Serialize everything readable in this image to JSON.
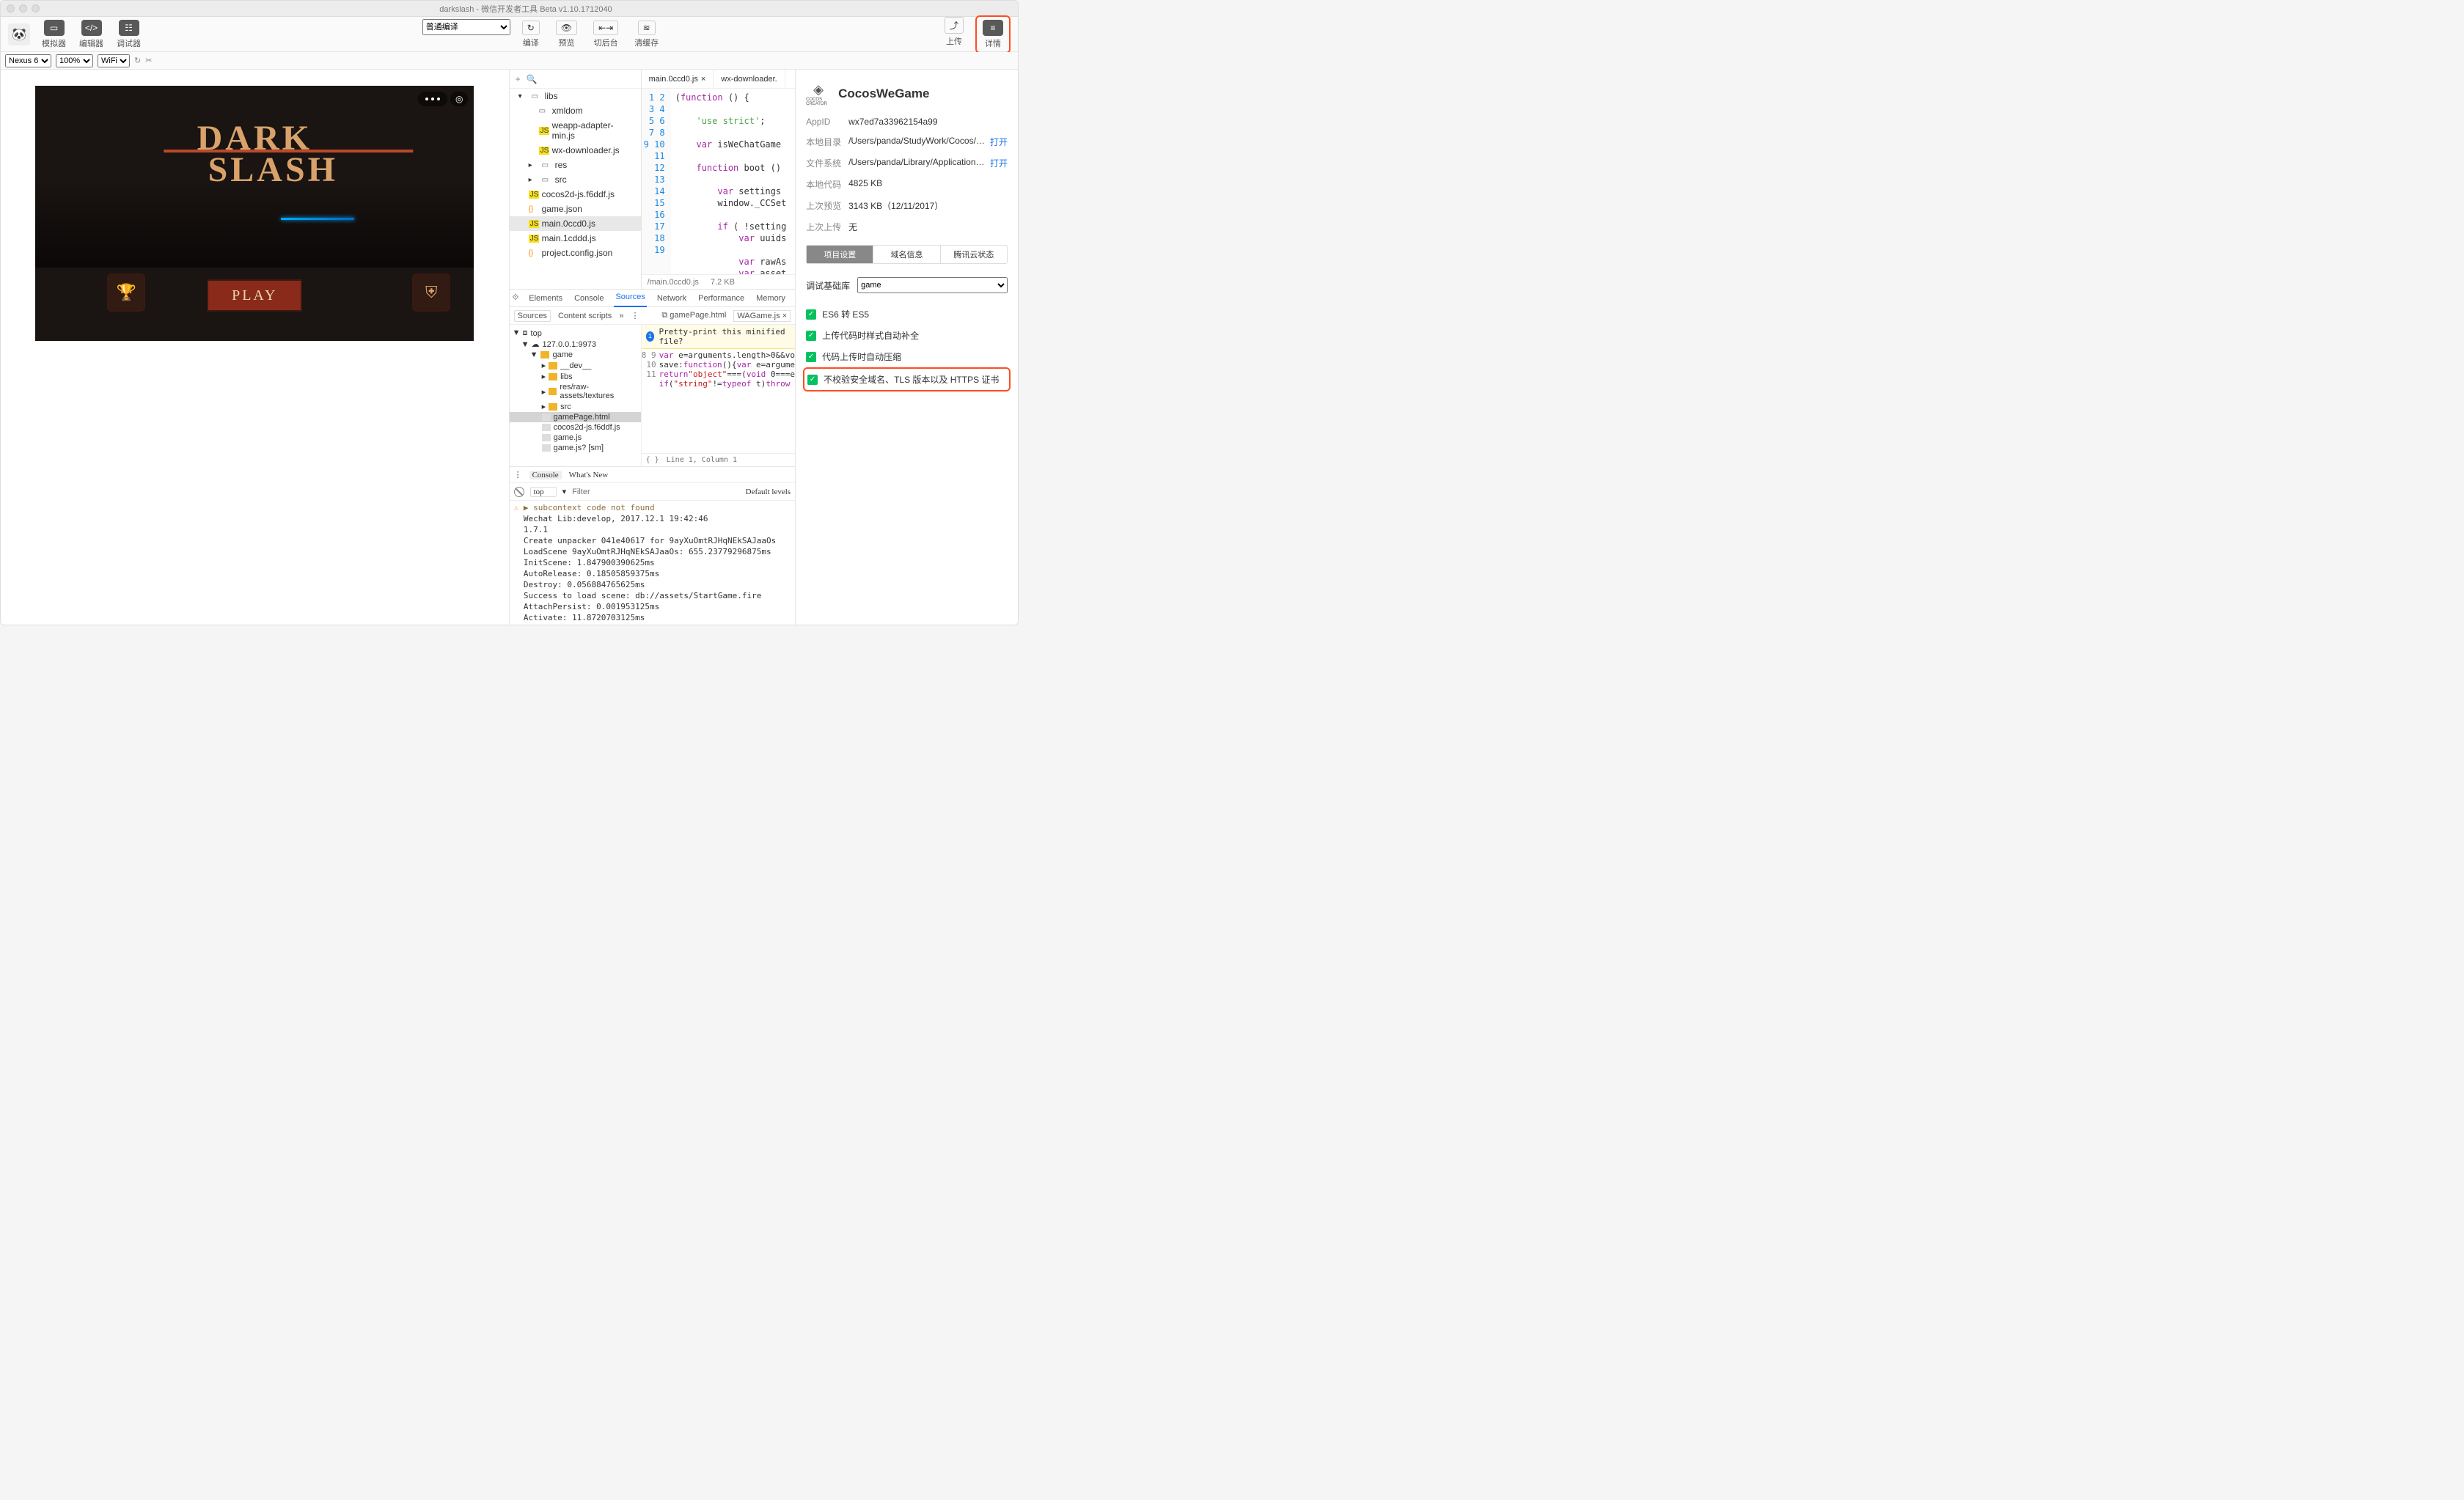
{
  "titlebar": {
    "title": "darkslash - 微信开发者工具 Beta v1.10.1712040"
  },
  "toolbar": {
    "simulator": "模拟器",
    "editor": "编辑器",
    "debugger": "调试器",
    "compile_mode": "普通编译",
    "compile": "编译",
    "preview": "预览",
    "background": "切后台",
    "clear_cache": "清缓存",
    "upload": "上传",
    "details": "详情"
  },
  "subbar": {
    "device": "Nexus 6",
    "zoom": "100%",
    "network": "WiFi"
  },
  "game": {
    "title_top": "DARK",
    "title_bottom": "SLASH",
    "play": "PLAY"
  },
  "file_tree": {
    "root": "libs",
    "items": [
      {
        "name": "xmldom",
        "type": "folder",
        "indent": 2
      },
      {
        "name": "weapp-adapter-min.js",
        "type": "js",
        "indent": 2
      },
      {
        "name": "wx-downloader.js",
        "type": "js",
        "indent": 2
      },
      {
        "name": "res",
        "type": "folder",
        "indent": 1,
        "caret": true
      },
      {
        "name": "src",
        "type": "folder",
        "indent": 1,
        "caret": true
      },
      {
        "name": "cocos2d-js.f6ddf.js",
        "type": "js",
        "indent": 1
      },
      {
        "name": "game.json",
        "type": "json",
        "indent": 1
      },
      {
        "name": "main.0ccd0.js",
        "type": "js",
        "indent": 1,
        "selected": true
      },
      {
        "name": "main.1cddd.js",
        "type": "js",
        "indent": 1
      },
      {
        "name": "project.config.json",
        "type": "json",
        "indent": 1
      }
    ]
  },
  "code_tabs": {
    "tab1": "main.0ccd0.js",
    "tab2": "wx-downloader."
  },
  "code": {
    "line_start": 1,
    "line_end": 19,
    "text": "(function () {\n\n    'use strict';\n\n    var isWeChatGame\n\n    function boot ()\n\n        var settings\n        window._CCSet\n\n        if ( !setting\n            var uuids\n\n            var rawAs\n            var asset\n            var realR\n            for (var \n                var a",
    "path": "/main.0ccd0.js",
    "size": "7.2 KB"
  },
  "devtools": {
    "tabs": [
      "Elements",
      "Console",
      "Sources",
      "Network",
      "Performance",
      "Memory"
    ],
    "sources": "Sources",
    "content_scripts": "Content scripts",
    "source_tabs": {
      "t1": "gamePage.html",
      "t2": "WAGame.js"
    },
    "pretty": "Pretty-print this minified file?",
    "src_tree": {
      "top": "top",
      "host": "127.0.0.1:9973",
      "game": "game",
      "items": [
        "__dev__",
        "libs",
        "res/raw-assets/textures",
        "src",
        "gamePage.html",
        "cocos2d-js.f6ddf.js",
        "game.js",
        "game.js? [sm]"
      ]
    },
    "src_code": {
      "start": 8,
      "text": "var e=arguments.length>0&&vo\nsave:function(){var e=argume\nreturn\"object\"===(void 0===e\nif(\"string\"!=typeof t)throw "
    },
    "status": "Line 1, Column 1"
  },
  "console": {
    "tab1": "Console",
    "tab2": "What's New",
    "context": "top",
    "filter_placeholder": "Filter",
    "levels": "Default levels",
    "lines": "▶ subcontext code not found\nWechat Lib:develop, 2017.12.1 19:42:46\n1.7.1\nCreate unpacker 041e40617 for 9ayXuOmtRJHqNEkSAJaaOs\nLoadScene 9ayXuOmtRJHqNEkSAJaaOs: 655.23779296875ms\nInitScene: 1.847900390625ms\nAutoRelease: 0.18505859375ms\nDestroy: 0.056884765625ms\nSuccess to load scene: db://assets/StartGame.fire\nAttachPersist: 0.001953125ms\nActivate: 11.8720703125ms"
  },
  "details": {
    "project": "CocosWeGame",
    "rows": [
      {
        "k": "AppID",
        "v": "wx7ed7a33962154a99"
      },
      {
        "k": "本地目录",
        "v": "/Users/panda/StudyWork/Cocos/Project...",
        "link": "打开"
      },
      {
        "k": "文件系统",
        "v": "/Users/panda/Library/Application Suppo...",
        "link": "打开"
      },
      {
        "k": "本地代码",
        "v": "4825 KB"
      },
      {
        "k": "上次预览",
        "v": "3143 KB（12/11/2017）"
      },
      {
        "k": "上次上传",
        "v": "无"
      }
    ],
    "tabs": [
      "项目设置",
      "域名信息",
      "腾讯云状态"
    ],
    "debug_lib_label": "调试基础库",
    "debug_lib_value": "game",
    "checks": [
      "ES6 转 ES5",
      "上传代码时样式自动补全",
      "代码上传时自动压缩",
      "不校验安全域名、TLS 版本以及 HTTPS 证书"
    ]
  }
}
